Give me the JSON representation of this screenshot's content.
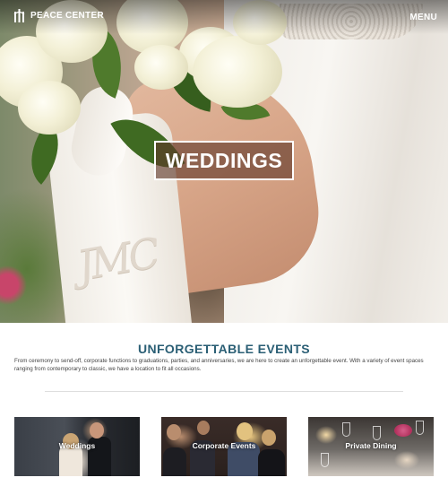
{
  "header": {
    "logo_text": "PEACE CENTER",
    "menu_label": "MENU"
  },
  "hero": {
    "title": "WEDDINGS",
    "monogram": "JMC"
  },
  "intro": {
    "title": "UNFORGETTABLE EVENTS",
    "description": "From ceremony to send-off, corporate functions to graduations, parties, and anniversaries, we are here to create an unforgettable event. With a variety of event spaces ranging from contemporary to classic, we have a location to fit all occasions."
  },
  "cards": [
    {
      "label": "Weddings"
    },
    {
      "label": "Corporate Events"
    },
    {
      "label": "Private Dining"
    }
  ],
  "colors": {
    "heading": "#2b5f75",
    "hero_box": "#5f3728"
  }
}
